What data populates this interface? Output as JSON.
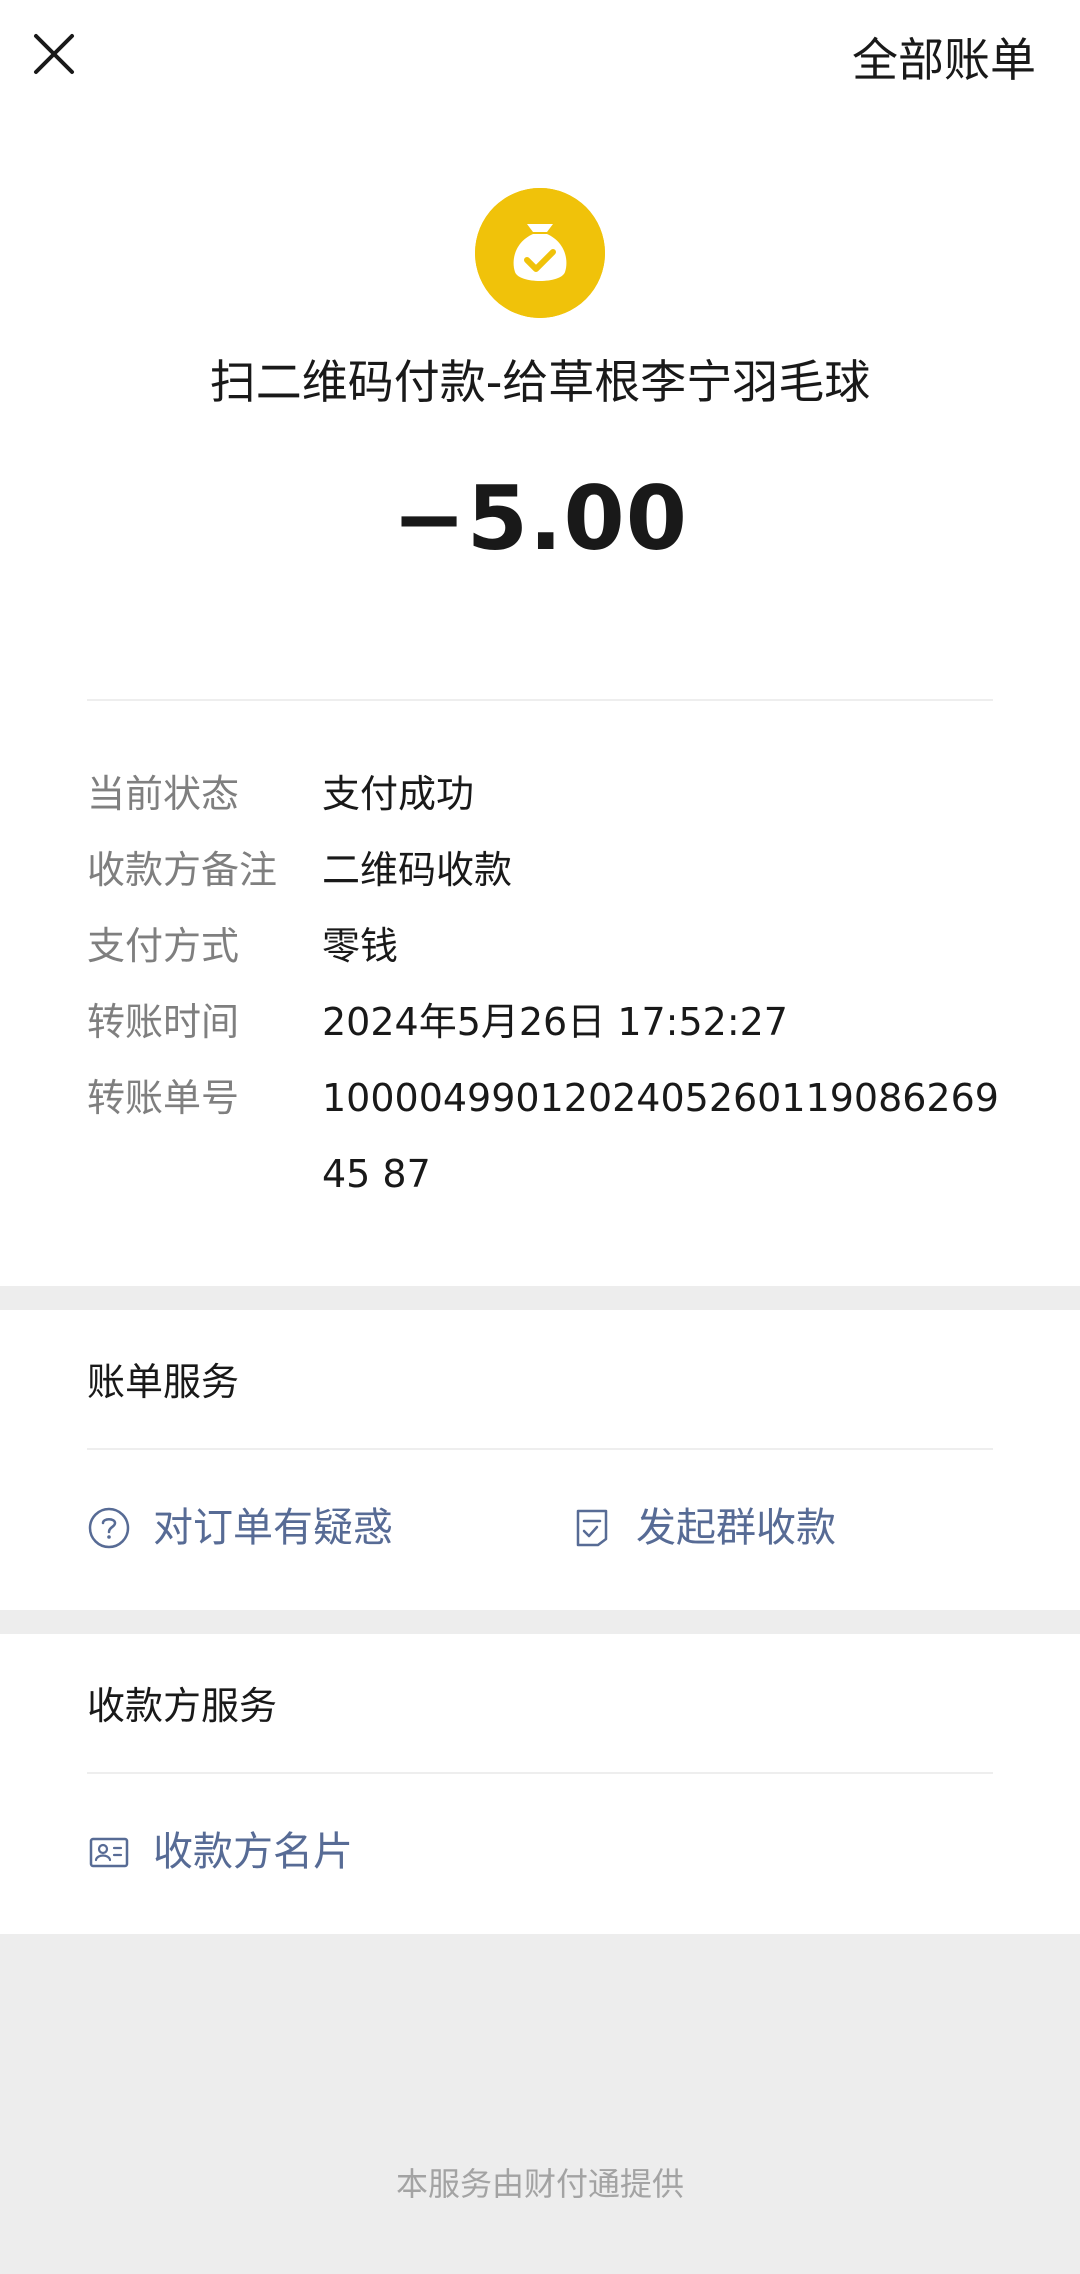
{
  "header": {
    "close_icon": "close-icon",
    "all_bills_label": "全部账单"
  },
  "summary": {
    "merchant_icon": "money-bag-check-icon",
    "accent_color": "#f0c20a",
    "title": "扫二维码付款-给草根李宁羽毛球",
    "amount": "−5.00"
  },
  "details": [
    {
      "label": "当前状态",
      "value": "支付成功"
    },
    {
      "label": "收款方备注",
      "value": "二维码收款"
    },
    {
      "label": "支付方式",
      "value": "零钱"
    },
    {
      "label": "转账时间",
      "value": "2024年5月26日 17:52:27"
    },
    {
      "label": "转账单号",
      "value": "100004990120240526011908626945 87"
    }
  ],
  "bill_services": {
    "title": "账单服务",
    "items": [
      {
        "label": "对订单有疑惑",
        "icon": "question-circle-icon"
      },
      {
        "label": "发起群收款",
        "icon": "document-check-icon"
      }
    ]
  },
  "payee_services": {
    "title": "收款方服务",
    "items": [
      {
        "label": "收款方名片",
        "icon": "contact-card-icon"
      }
    ]
  },
  "footer": {
    "note": "本服务由财付通提供"
  },
  "colors": {
    "link": "#576b95",
    "label": "#7f7f7f",
    "background": "#ededed"
  }
}
